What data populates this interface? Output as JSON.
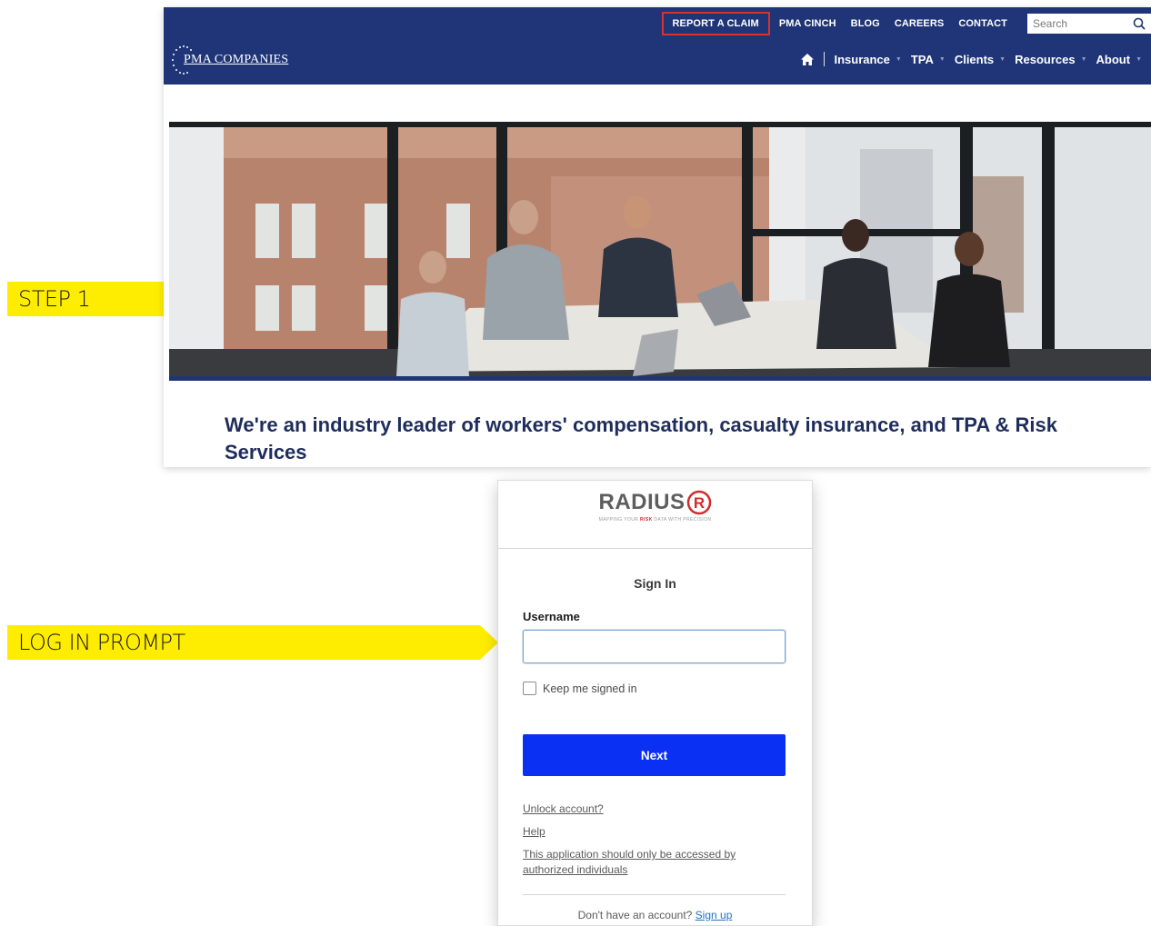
{
  "callouts": {
    "step1": "STEP 1",
    "login": "LOG IN PROMPT"
  },
  "pma": {
    "logo_text": "PMA COMPANIES",
    "top_links": [
      "REPORT A CLAIM",
      "PMA CINCH",
      "BLOG",
      "CAREERS",
      "CONTACT"
    ],
    "search_placeholder": "Search",
    "main_nav": [
      "Insurance",
      "TPA",
      "Clients",
      "Resources",
      "About"
    ],
    "headline": "We're an industry leader of workers' compensation, casualty insurance, and TPA & Risk Services",
    "colors": {
      "header": "#1f3577",
      "claim_highlight": "#d8322d",
      "headline": "#1e2d5c"
    }
  },
  "login": {
    "brand": "RADIUS",
    "tagline_pre": "MAPPING YOUR ",
    "tagline_risk": "RISK",
    "tagline_post": " DATA WITH PRECISION",
    "title": "Sign In",
    "username_label": "Username",
    "username_value": "",
    "keep_signed_in": "Keep me signed in",
    "keep_signed_in_checked": false,
    "next_label": "Next",
    "unlock_link": "Unlock account?",
    "help_link": "Help",
    "notice_link": "This application should only be accessed by authorized individuals",
    "no_account_text": "Don't have an account?",
    "signup_link": "Sign up",
    "colors": {
      "next_button": "#0a30f4",
      "brand_red": "#d42a2a"
    }
  },
  "icons": {
    "search": "search-icon",
    "home": "home-icon",
    "caret": "caret-down-icon",
    "logo_stars": "stars-icon",
    "radius_r": "registered-r-icon"
  }
}
